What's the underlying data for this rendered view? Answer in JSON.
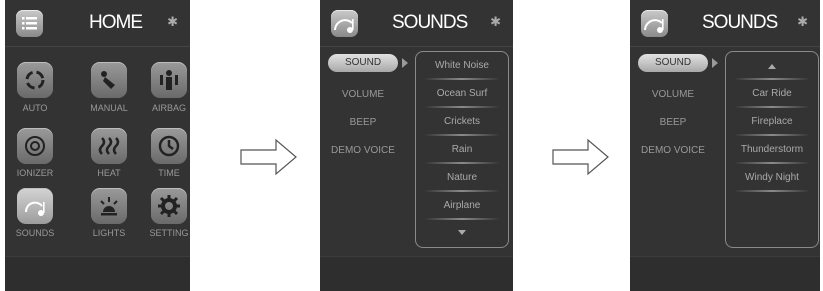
{
  "home": {
    "title": "HOME",
    "tiles": [
      {
        "label": "AUTO",
        "icon": "auto-icon"
      },
      {
        "label": "MANUAL",
        "icon": "manual-icon"
      },
      {
        "label": "AIRBAG",
        "icon": "airbag-icon"
      },
      {
        "label": "IONIZER",
        "icon": "ionizer-icon"
      },
      {
        "label": "HEAT",
        "icon": "heat-icon"
      },
      {
        "label": "TIME",
        "icon": "time-icon"
      },
      {
        "label": "SOUNDS",
        "icon": "sounds-icon"
      },
      {
        "label": "LIGHTS",
        "icon": "lights-icon"
      },
      {
        "label": "SETTING",
        "icon": "setting-icon"
      }
    ]
  },
  "sounds": {
    "title": "SOUNDS",
    "menu": [
      "SOUND",
      "VOLUME",
      "BEEP",
      "DEMO VOICE"
    ],
    "list_page1": [
      "White Noise",
      "Ocean Surf",
      "Crickets",
      "Rain",
      "Nature",
      "Airplane"
    ],
    "list_page2": [
      "Car Ride",
      "Fireplace",
      "Thunderstorm",
      "Windy Night"
    ]
  },
  "colors": {
    "screen_bg": "#333333",
    "selected_pill": "#c8c8c8",
    "label": "#999999"
  }
}
